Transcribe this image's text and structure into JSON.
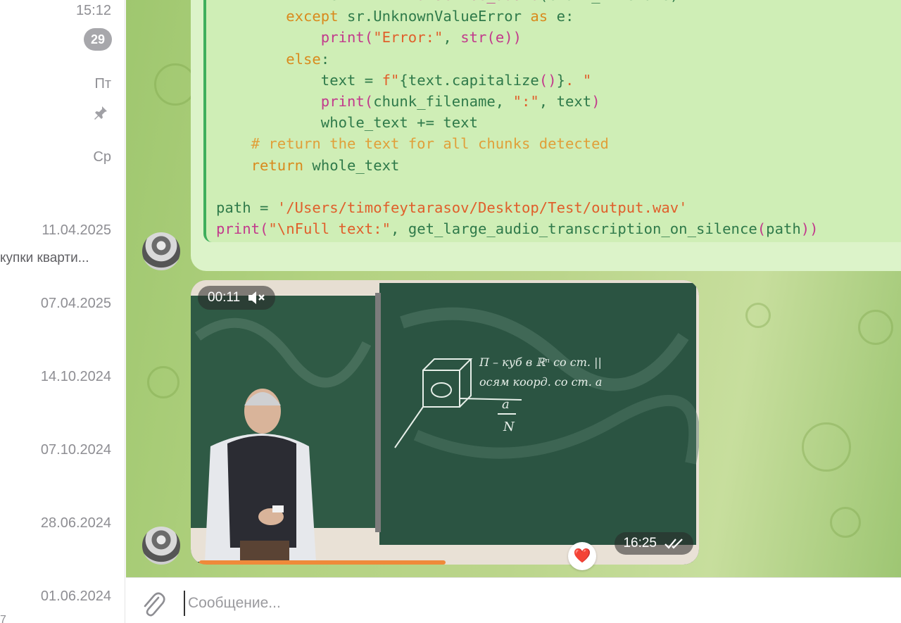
{
  "chat_list": {
    "items": [
      {
        "date": "15:12",
        "badge": "29"
      },
      {
        "date": "Пт",
        "pinned": true
      },
      {
        "date": "Ср"
      },
      {
        "date": "11.04.2025",
        "preview": "купки кварти..."
      },
      {
        "date": "07.04.2025"
      },
      {
        "date": "14.10.2024"
      },
      {
        "date": "07.10.2024"
      },
      {
        "date": "28.06.2024"
      },
      {
        "date": "01.06.2024"
      }
    ],
    "bottom_fragment": "7"
  },
  "code_message": {
    "lines": [
      [
        [
          "            ",
          "id"
        ],
        [
          "text",
          "id"
        ],
        [
          " = ",
          "id"
        ],
        [
          "r",
          "id"
        ],
        [
          ".",
          "id"
        ],
        [
          "transcribe_audio",
          "fn"
        ],
        [
          "(",
          "id"
        ],
        [
          "chunk_filename",
          "id"
        ],
        [
          ")",
          "id"
        ]
      ],
      [
        [
          "        ",
          "id"
        ],
        [
          "except",
          "kw"
        ],
        [
          " sr.",
          "id"
        ],
        [
          "UnknownValueError",
          "id"
        ],
        [
          " as ",
          "kw"
        ],
        [
          "e:",
          "id"
        ]
      ],
      [
        [
          "            ",
          "id"
        ],
        [
          "print",
          "fn"
        ],
        [
          "(",
          "fn"
        ],
        [
          "\"Error:\"",
          "str"
        ],
        [
          ", ",
          "id"
        ],
        [
          "str",
          "fn"
        ],
        [
          "(e))",
          "fn"
        ]
      ],
      [
        [
          "        ",
          "id"
        ],
        [
          "else",
          "kw"
        ],
        [
          ":",
          "id"
        ]
      ],
      [
        [
          "            ",
          "id"
        ],
        [
          "text",
          "id"
        ],
        [
          " = ",
          "id"
        ],
        [
          "f\"",
          "str"
        ],
        [
          "{",
          "id"
        ],
        [
          "text.",
          "id"
        ],
        [
          "capitalize",
          "id"
        ],
        [
          "()",
          "fn"
        ],
        [
          "}",
          "id"
        ],
        [
          ". \"",
          "str"
        ]
      ],
      [
        [
          "            ",
          "id"
        ],
        [
          "print",
          "fn"
        ],
        [
          "(",
          "fn"
        ],
        [
          "chunk_filename, ",
          "id"
        ],
        [
          "\":\"",
          "str"
        ],
        [
          ", text",
          "id"
        ],
        [
          ")",
          "fn"
        ]
      ],
      [
        [
          "            ",
          "id"
        ],
        [
          "whole_text += text",
          "id"
        ]
      ],
      [
        [
          "    ",
          "id"
        ],
        [
          "# return the text for all chunks detected",
          "cm"
        ]
      ],
      [
        [
          "    ",
          "id"
        ],
        [
          "return",
          "kw"
        ],
        [
          " whole_text",
          "id"
        ]
      ],
      [
        [
          "",
          "id"
        ]
      ],
      [
        [
          "path",
          "id"
        ],
        [
          " = ",
          "id"
        ],
        [
          "'/Users/timofeytarasov/Desktop/Test/output.wav'",
          "str"
        ]
      ],
      [
        [
          "print",
          "fn"
        ],
        [
          "(",
          "fn"
        ],
        [
          "\"\\nFull text:\"",
          "str"
        ],
        [
          ", ",
          "id"
        ],
        [
          "get_large_audio_transcription_on_silence",
          "id"
        ],
        [
          "(",
          "fn"
        ],
        [
          "path",
          "id"
        ],
        [
          "))",
          "fn"
        ]
      ]
    ]
  },
  "video_message": {
    "duration_left": "00:11",
    "muted": true,
    "sent_time": "16:25",
    "status": "read",
    "progress": 0.5,
    "reaction": "❤️",
    "board_text": [
      "П – куб в ℝⁿ со ст. ||",
      "осям коорд. со ст. a",
      "a",
      "N"
    ]
  },
  "compose": {
    "placeholder": "Сообщение..."
  },
  "colors": {
    "accent_green": "#3fae5b",
    "bubble_bg": "#dcf3c9",
    "progress": "#ef8a3a",
    "heart": "#e0223a"
  }
}
